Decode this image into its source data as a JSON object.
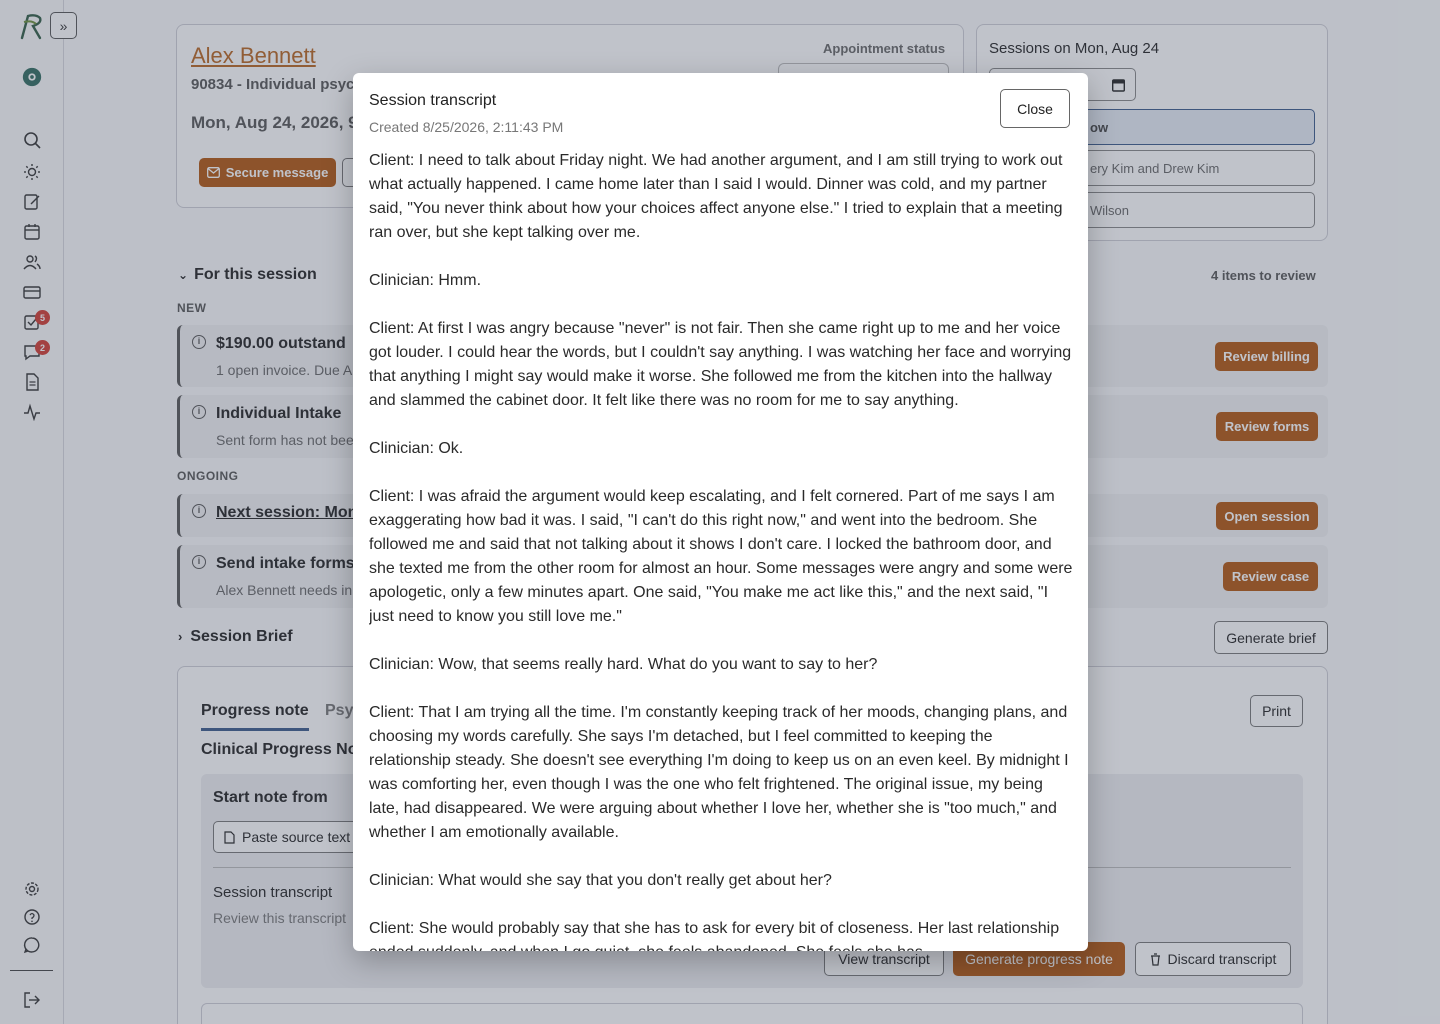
{
  "sidebar": {
    "expand_label": "»",
    "tasks_badge": "5",
    "messages_badge": "2",
    "icons": [
      "search-icon",
      "sun-icon",
      "edit-note-icon",
      "calendar-icon",
      "users-icon",
      "credit-card-icon",
      "tasks-icon",
      "messages-icon",
      "document-icon",
      "activity-icon",
      "settings-icon",
      "help-icon",
      "chat-icon",
      "logout-icon"
    ]
  },
  "client": {
    "name": "Alex Bennett",
    "service": "90834 - Individual psyc",
    "date": "Mon, Aug 24, 2026, 9",
    "secure_message_label": "Secure message"
  },
  "appointment": {
    "status_label": "Appointment status"
  },
  "sessions": {
    "title": "Sessions on Mon, Aug 24",
    "items": [
      "ow",
      "ery Kim and Drew Kim",
      "Wilson"
    ]
  },
  "for_session": {
    "title": "For this session",
    "items_to_review": "4 items to review",
    "new_label": "NEW",
    "ongoing_label": "ONGOING",
    "rows": [
      {
        "title": "$190.00 outstand",
        "sub": "1 open invoice. Due A",
        "action": "Review billing"
      },
      {
        "title": "Individual Intake",
        "sub": "Sent form has not bee",
        "action": "Review forms"
      },
      {
        "title": "Next session: Mon",
        "sub": "",
        "action": "Open session"
      },
      {
        "title": "Send intake forms",
        "sub": "Alex Bennett needs in",
        "action": "Review case"
      }
    ]
  },
  "session_brief": {
    "title": "Session Brief",
    "generate_label": "Generate brief"
  },
  "note": {
    "tab_progress": "Progress note",
    "tab_psy": "Psy",
    "print_label": "Print",
    "heading": "Clinical Progress No",
    "start_from": "Start note from",
    "paste_label": "Paste source text",
    "transcript_title": "Session transcript",
    "transcript_sub": "Review this transcript",
    "view_transcript": "View transcript",
    "generate_note": "Generate progress note",
    "discard_transcript": "Discard transcript"
  },
  "modal": {
    "title": "Session transcript",
    "created": "Created 8/25/2026, 2:11:43 PM",
    "close_label": "Close",
    "transcript": [
      "Client: I need to talk about Friday night. We had another argument, and I am still trying to work out what actually happened. I came home later than I said I would. Dinner was cold, and my partner said, \"You never think about how your choices affect anyone else.\" I tried to explain that a meeting ran over, but she kept talking over me.",
      "Clinician: Hmm.",
      "Client: At first I was angry because \"never\" is not fair. Then she came right up to me and her voice got louder. I could hear the words, but I couldn't say anything. I was watching her face and worrying that anything I might say would make it worse. She followed me from the kitchen into the hallway and slammed the cabinet door. It felt like there was no room for me to say anything.",
      "Clinician: Ok.",
      "Client: I was afraid the argument would keep escalating, and I felt cornered. Part of me says I am exaggerating how bad it was. I said, \"I can't do this right now,\" and went into the bedroom. She followed me and said that not talking about it shows I don't care. I locked the bathroom door, and she texted me from the other room for almost an hour. Some messages were angry and some were apologetic, only a few minutes apart. One said, \"You make me act like this,\" and the next said, \"I just need to know you still love me.\"",
      "Clinician: Wow, that seems really hard. What do you want to say to her?",
      "Client: That I am trying all the time. I'm constantly keeping track of her moods, changing plans, and choosing my words carefully. She says I'm detached, but I feel committed to keeping the relationship steady. She doesn't see everything I'm doing to keep us on an even keel. By midnight I was comforting her, even though I was the one who felt frightened. The original issue, my being late, had disappeared. We were arguing about whether I love her, whether she is \"too much,\" and whether I am emotionally available.",
      "Clinician: What would she say that you don't really get about her?",
      "Client: She would probably say that she has to ask for every bit of closeness. Her last relationship ended suddenly, and when I go quiet, she feels abandoned. She feels she has"
    ]
  }
}
